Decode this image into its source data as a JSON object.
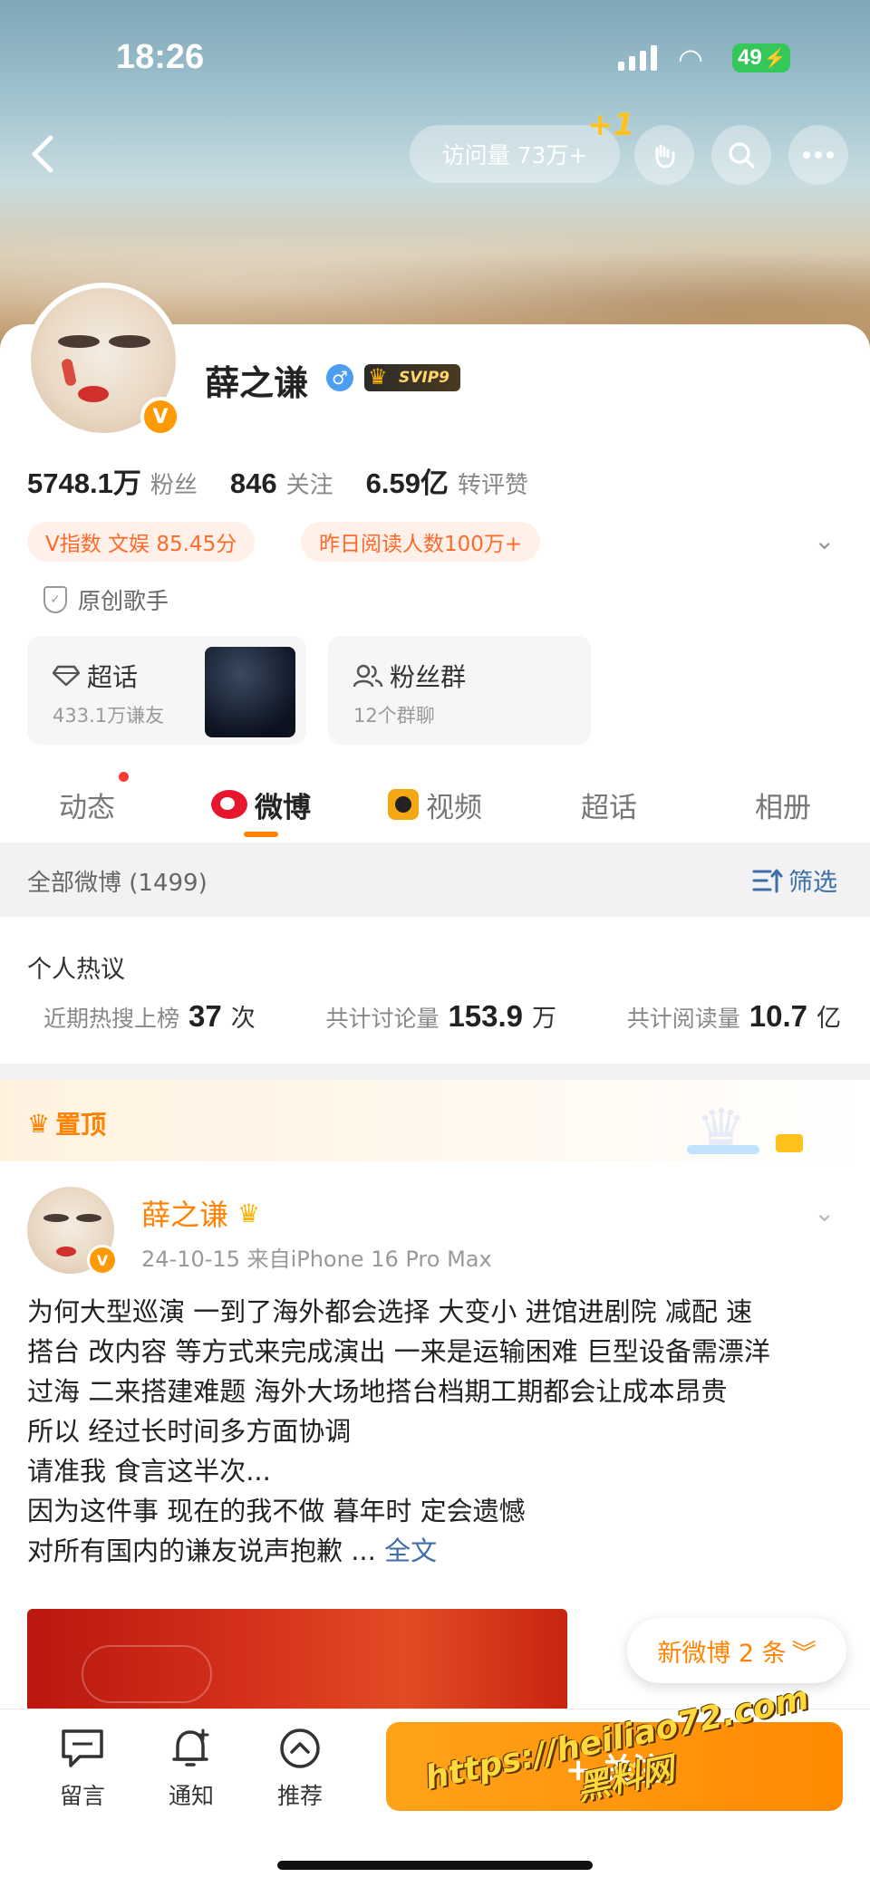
{
  "status_bar": {
    "time": "18:26",
    "battery": "49"
  },
  "header": {
    "visit_count": "访问量 73万+",
    "visit_increment": "+1"
  },
  "profile": {
    "name": "薛之谦",
    "vip_badge": "SVIP9",
    "stats": [
      {
        "value": "5748.1万",
        "label": "粉丝"
      },
      {
        "value": "846",
        "label": "关注"
      },
      {
        "value": "6.59亿",
        "label": "转评赞"
      }
    ],
    "tags": [
      "V指数 文娱 85.45分",
      "昨日阅读人数100万+"
    ],
    "certification": "原创歌手",
    "supertopic": {
      "title": "超话",
      "subtitle": "433.1万谦友"
    },
    "fan_group": {
      "title": "粉丝群",
      "subtitle": "12个群聊"
    }
  },
  "tabs": [
    {
      "label": "动态",
      "has_dot": true
    },
    {
      "label": "微博",
      "active": true
    },
    {
      "label": "视频"
    },
    {
      "label": "超话"
    },
    {
      "label": "相册"
    }
  ],
  "filter": {
    "left": "全部微博 (1499)",
    "right": "筛选"
  },
  "hot": {
    "title": "个人热议",
    "items": [
      {
        "label": "近期热搜上榜",
        "value": "37",
        "unit": "次"
      },
      {
        "label": "共计讨论量",
        "value": "153.9",
        "unit": "万"
      },
      {
        "label": "共计阅读量",
        "value": "10.7",
        "unit": "亿"
      }
    ]
  },
  "pinned": {
    "label": "置顶",
    "author": "薛之谦",
    "meta": "24-10-15  来自iPhone 16 Pro Max",
    "lines": [
      "为何大型巡演 一到了海外都会选择 大变小 进馆进剧院 减配 速",
      "搭台 改内容 等方式来完成演出 一来是运输困难 巨型设备需漂洋",
      "过海 二来搭建难题 海外大场地搭台档期工期都会让成本昂贵",
      "所以 经过长时间多方面协调",
      "请准我 食言这半次...",
      "因为这件事 现在的我不做 暮年时 定会遗憾"
    ],
    "last_line": "对所有国内的谦友说声抱歉 ... ",
    "full_text": "全文"
  },
  "new_posts": "新微博 2 条",
  "bottom_bar": {
    "items": [
      {
        "label": "留言",
        "icon": "message-icon"
      },
      {
        "label": "通知",
        "icon": "bell-plus-icon"
      },
      {
        "label": "推荐",
        "icon": "chevron-up-circle-icon"
      }
    ],
    "follow_label": "+ 关注"
  },
  "watermark": {
    "line1": "https://heiliao72.com",
    "line2": "黑料网"
  },
  "colors": {
    "accent": "#ff8200",
    "link": "#3d6ea8",
    "tag_bg": "#fff1ea"
  }
}
